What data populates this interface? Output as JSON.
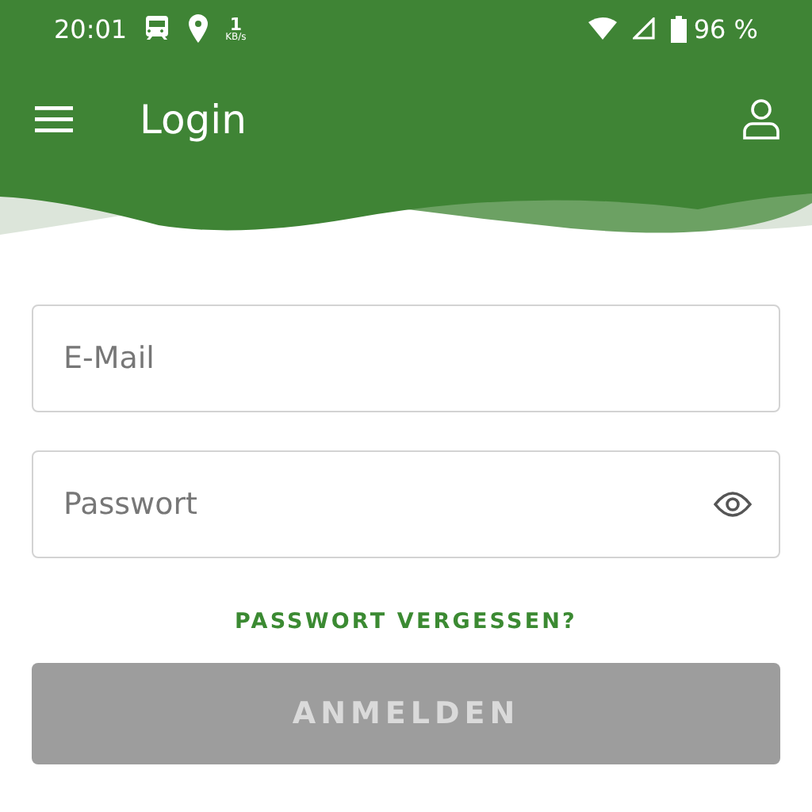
{
  "status_bar": {
    "time": "20:01",
    "speed": "1",
    "speed_unit": "KB/s",
    "battery": "96 %"
  },
  "app_bar": {
    "title": "Login"
  },
  "fields": [
    {
      "placeholder": "E-Mail",
      "kind": "text"
    },
    {
      "placeholder": "Passwort",
      "kind": "password"
    }
  ],
  "forgot_link": "PASSWORT VERGESSEN?",
  "login_button": {
    "label": "ANMELDEN",
    "disabled": true
  }
}
